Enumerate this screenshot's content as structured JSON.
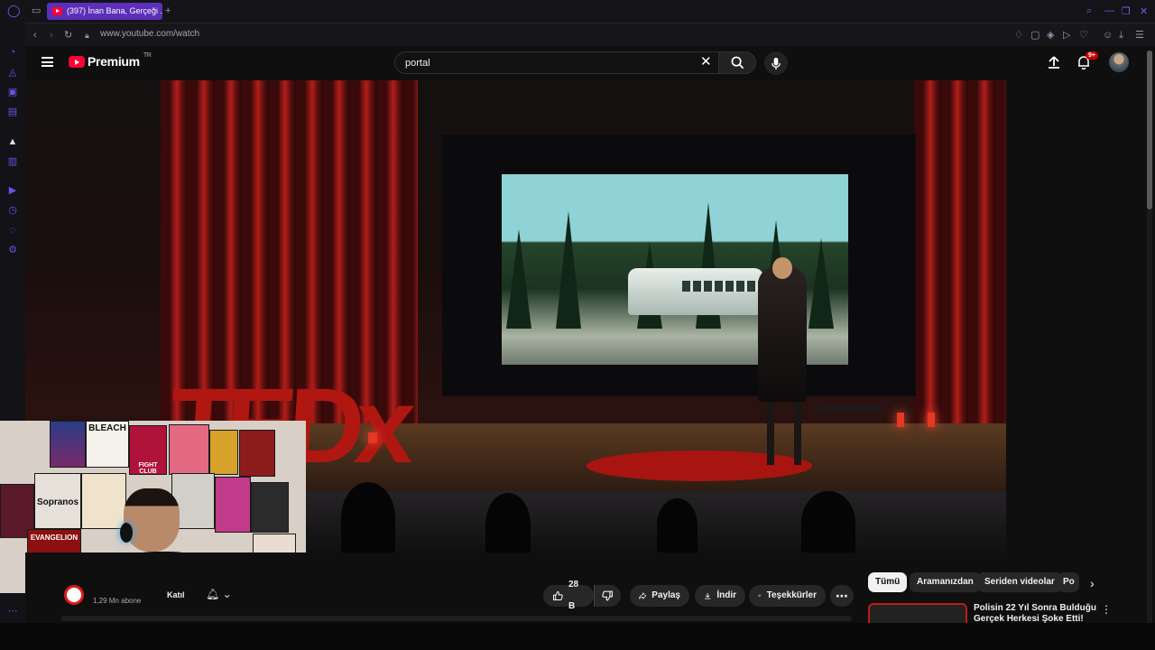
{
  "browser": {
    "tab_title": "(397) İnan Bana, Gerçeği ...",
    "url": "www.youtube.com/watch",
    "new_tab_symbol": "+"
  },
  "header": {
    "brand": "Premium",
    "region": "TR",
    "search_value": "portal",
    "notification_badge": "9+"
  },
  "channel": {
    "subscribers": "1,29 Mn abone",
    "join_label": "Katıl"
  },
  "actions": {
    "like_count": "28 B",
    "share_label": "Paylaş",
    "download_label": "İndir",
    "thanks_label": "Teşekkürler"
  },
  "chips": [
    "Tümü",
    "Aramanızdan",
    "Seriden videolar",
    "Po"
  ],
  "recommendation": {
    "title": "Polisin 22 Yıl Sonra Bulduğu Gerçek Herkesi Şoke Etti!"
  },
  "video": {
    "stage_letters": "TEDx"
  },
  "webcam_posters": [
    "BLEACH",
    "FIGHT CLUB",
    "Sopranos",
    "EVANGELION",
    "RUMBLING"
  ],
  "colors": {
    "accent": "#6f4fe6",
    "tab": "#5b2fb8",
    "youtube_red": "#ff0033",
    "background": "#0f0f0f"
  },
  "icons": [
    "opera-logo",
    "tabs-icon",
    "back-icon",
    "forward-icon",
    "reload-icon",
    "lock-icon",
    "search-icon",
    "minimize-icon",
    "restore-icon",
    "close-icon",
    "menu-icon",
    "clear-icon",
    "mic-icon",
    "upload-icon",
    "bell-icon",
    "like-icon",
    "dislike-icon",
    "share-icon",
    "download-icon",
    "thanks-icon",
    "more-icon",
    "chevron-right-icon"
  ]
}
